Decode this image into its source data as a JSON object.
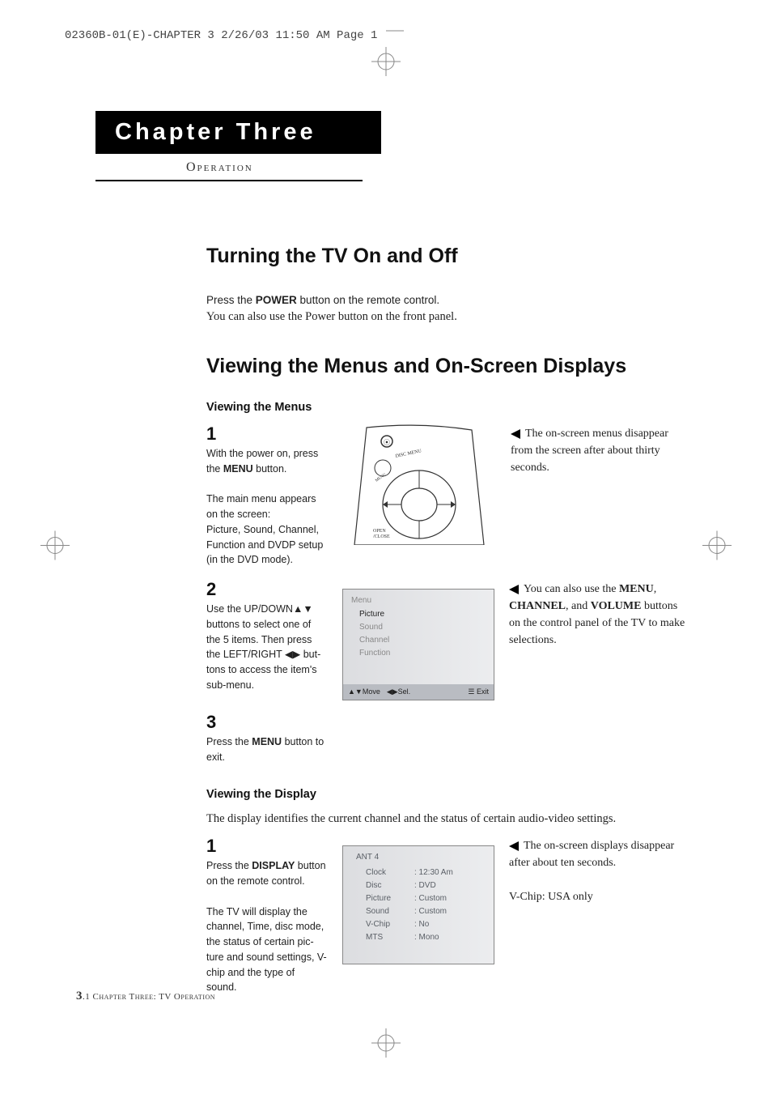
{
  "header_line": "02360B-01(E)-CHAPTER 3  2/26/03  11:50 AM  Page 1",
  "chapter_title": "Chapter Three",
  "operation_label": "Operation",
  "section1_title": "Turning the TV On and Off",
  "section1_body_sans_pre": "Press the ",
  "section1_body_sans_bold": "POWER",
  "section1_body_sans_post": " button on the remote control.",
  "section1_body_serif": "You can also use the Power button on the front panel.",
  "section2_title": "Viewing the Menus and On-Screen Displays",
  "sub_viewing_menus": "Viewing the Menus",
  "step1_num": "1",
  "step1_line1_pre": "With the power on, press the ",
  "step1_line1_bold": "MENU",
  "step1_line1_post": " button.",
  "step1_line2": "The main menu appears on the screen:",
  "step1_line3": "Picture, Sound, Channel, Function and DVDP setup (in the DVD mode).",
  "step1_note": "The on-screen menus disappear from the screen after about thirty seconds.",
  "step2_num": "2",
  "step2_text_a": "Use the UP/DOWN▲▼ buttons to select one of the 5 items. Then press the LEFT/RIGHT ◀▶ but-tons to access the item's sub-menu.",
  "step2_note_pre": "You can also use the ",
  "step2_note_b1": "MENU",
  "step2_note_mid1": ", ",
  "step2_note_b2": "CHANNEL",
  "step2_note_mid2": ", and ",
  "step2_note_b3": "VOLUME",
  "step2_note_post": " buttons on the control panel of the TV to make selections.",
  "menu_box_title": "Menu",
  "menu_items": [
    "Picture",
    "Sound",
    "Channel",
    "Function"
  ],
  "menu_footer_move": "▲▼Move",
  "menu_footer_sel": "◀▶Sel.",
  "menu_footer_exit": "☰ Exit",
  "step3_num": "3",
  "step3_text_pre": "Press the ",
  "step3_text_bold": "MENU",
  "step3_text_post": " button to exit.",
  "sub_viewing_display": "Viewing the Display",
  "viewing_display_intro": "The display identifies the current channel and the status of certain audio-video settings.",
  "d_step1_num": "1",
  "d_step1_text_pre": "Press the ",
  "d_step1_text_bold": "DISPLAY",
  "d_step1_text_post": " button on the remote control.",
  "d_step1_text2": "The TV will display the channel, Time, disc mode, the status of certain pic-ture and sound settings, V-chip and the type of sound.",
  "d_step1_note1": "The on-screen displays disappear after about ten seconds.",
  "d_step1_note2": "V-Chip: USA only",
  "display_ant": "ANT  4",
  "display_rows": [
    {
      "k": "Clock",
      "v": ": 12:30  Am"
    },
    {
      "k": "Disc",
      "v": ": DVD"
    },
    {
      "k": "Picture",
      "v": ": Custom"
    },
    {
      "k": "Sound",
      "v": ": Custom"
    },
    {
      "k": "V-Chip",
      "v": ": No"
    },
    {
      "k": "MTS",
      "v": ": Mono"
    }
  ],
  "footer_page_num": "3",
  "footer_page_sub": ".1",
  "footer_text": " Chapter Three: TV Operation",
  "remote_open_close": "OPEN/CLOSE",
  "remote_disc_menu": "DISC MENU",
  "remote_menu": "MENU"
}
